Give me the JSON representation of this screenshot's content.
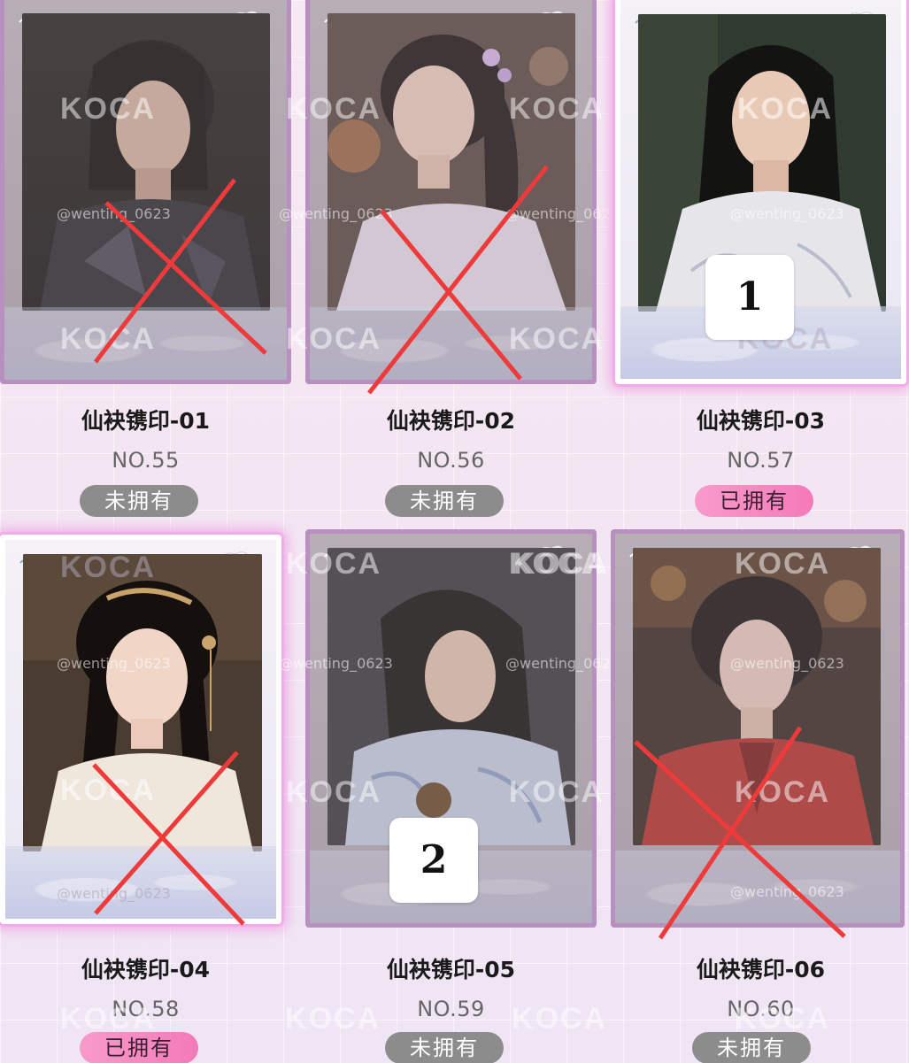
{
  "watermark": {
    "brand": "KOCA",
    "handle": "@wenting_0623"
  },
  "markers": {
    "one": "1",
    "two": "2"
  },
  "cards": [
    {
      "title": "仙袂镌印-01",
      "number": "NO.55",
      "status": "未拥有",
      "crossed": true,
      "owned": false
    },
    {
      "title": "仙袂镌印-02",
      "number": "NO.56",
      "status": "未拥有",
      "crossed": true,
      "owned": false
    },
    {
      "title": "仙袂镌印-03",
      "number": "NO.57",
      "status": "已拥有",
      "crossed": false,
      "owned": true
    },
    {
      "title": "仙袂镌印-04",
      "number": "NO.58",
      "status": "已拥有",
      "crossed": true,
      "owned": true
    },
    {
      "title": "仙袂镌印-05",
      "number": "NO.59",
      "status": "未拥有",
      "crossed": false,
      "owned": false
    },
    {
      "title": "仙袂镌印-06",
      "number": "NO.60",
      "status": "未拥有",
      "crossed": true,
      "owned": false
    }
  ],
  "colors": {
    "status_unowned": "#8c8c8c",
    "status_owned": "#f47ab8",
    "owned_glow": "#f0a7e6",
    "cross": "#ee3a3a"
  }
}
